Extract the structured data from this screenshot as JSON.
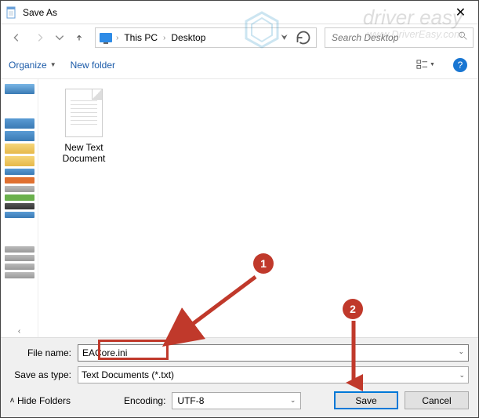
{
  "window": {
    "title": "Save As"
  },
  "nav": {
    "breadcrumb": {
      "item1": "This PC",
      "item2": "Desktop"
    },
    "search_placeholder": "Search Desktop"
  },
  "toolbar": {
    "organize": "Organize",
    "newfolder": "New folder"
  },
  "content": {
    "file1": {
      "name_line1": "New Text",
      "name_line2": "Document"
    }
  },
  "fields": {
    "filename_label": "File name:",
    "filename_value": "EACore.ini",
    "savetype_label": "Save as type:",
    "savetype_value": "Text Documents (*.txt)",
    "hide_folders": "Hide Folders",
    "encoding_label": "Encoding:",
    "encoding_value": "UTF-8",
    "save": "Save",
    "cancel": "Cancel"
  },
  "annotations": {
    "badge1": "1",
    "badge2": "2"
  },
  "watermark": {
    "line1": "driver easy",
    "line2": "www.DriverEasy.com"
  }
}
